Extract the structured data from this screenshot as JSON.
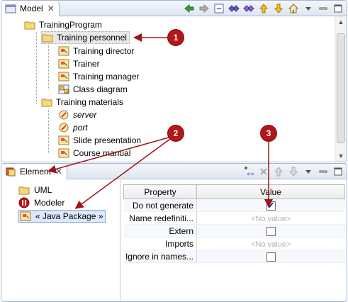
{
  "top_panel": {
    "tab_label": "Model",
    "tab_close_glyph": "✕",
    "toolbar_icons": [
      "back-arrow-icon",
      "forward-arrow-icon",
      "collapse-all-icon",
      "link-icon",
      "link-icon-2",
      "up-icon",
      "down-icon",
      "home-icon",
      "view-menu-icon",
      "minimize-icon",
      "maximize-icon"
    ],
    "tree": [
      {
        "label": "TrainingProgram",
        "icon": "folder-icon",
        "italic": false
      },
      {
        "label": "Training personnel",
        "icon": "package-icon",
        "italic": false,
        "selected": true
      },
      {
        "label": "Training director",
        "icon": "diagram-icon",
        "italic": false
      },
      {
        "label": "Trainer",
        "icon": "diagram-icon",
        "italic": false
      },
      {
        "label": "Training manager",
        "icon": "diagram-icon",
        "italic": false
      },
      {
        "label": "Class diagram",
        "icon": "class-diagram-icon",
        "italic": false
      },
      {
        "label": "Training materials",
        "icon": "package-icon",
        "italic": false
      },
      {
        "label": "server",
        "icon": "component-icon",
        "italic": true
      },
      {
        "label": "port",
        "icon": "component-icon",
        "italic": true
      },
      {
        "label": "Slide presentation",
        "icon": "diagram-icon",
        "italic": false
      },
      {
        "label": "Course manual",
        "icon": "diagram-icon",
        "italic": false
      }
    ]
  },
  "bottom_panel": {
    "tab_label": "Element",
    "tab_close_glyph": "✕",
    "toolbar_icons": [
      "add-stereotype-icon",
      "remove-icon",
      "move-up-icon",
      "move-down-icon",
      "view-menu-icon",
      "minimize-icon",
      "maximize-icon"
    ],
    "elements": [
      {
        "label": "UML",
        "icon": "folder-icon"
      },
      {
        "label": "Modeler",
        "icon": "modeler-icon"
      },
      {
        "label": "« Java Package »",
        "icon": "java-package-icon",
        "selected": true
      }
    ],
    "properties": {
      "col_property": "Property",
      "col_value": "Value",
      "rows": [
        {
          "name": "Do not generate",
          "type": "checkbox",
          "checked": true
        },
        {
          "name": "Name redefiniti...",
          "type": "text",
          "value": "<No value>"
        },
        {
          "name": "Extern",
          "type": "checkbox",
          "checked": false
        },
        {
          "name": "Imports",
          "type": "text",
          "value": "<No value>"
        },
        {
          "name": "Ignore in names...",
          "type": "checkbox",
          "checked": false
        }
      ]
    }
  },
  "callouts": [
    "1",
    "2",
    "3"
  ],
  "colors": {
    "callout": "#b3161a",
    "border": "#a5b5cf",
    "selection": "#dce8fb"
  }
}
